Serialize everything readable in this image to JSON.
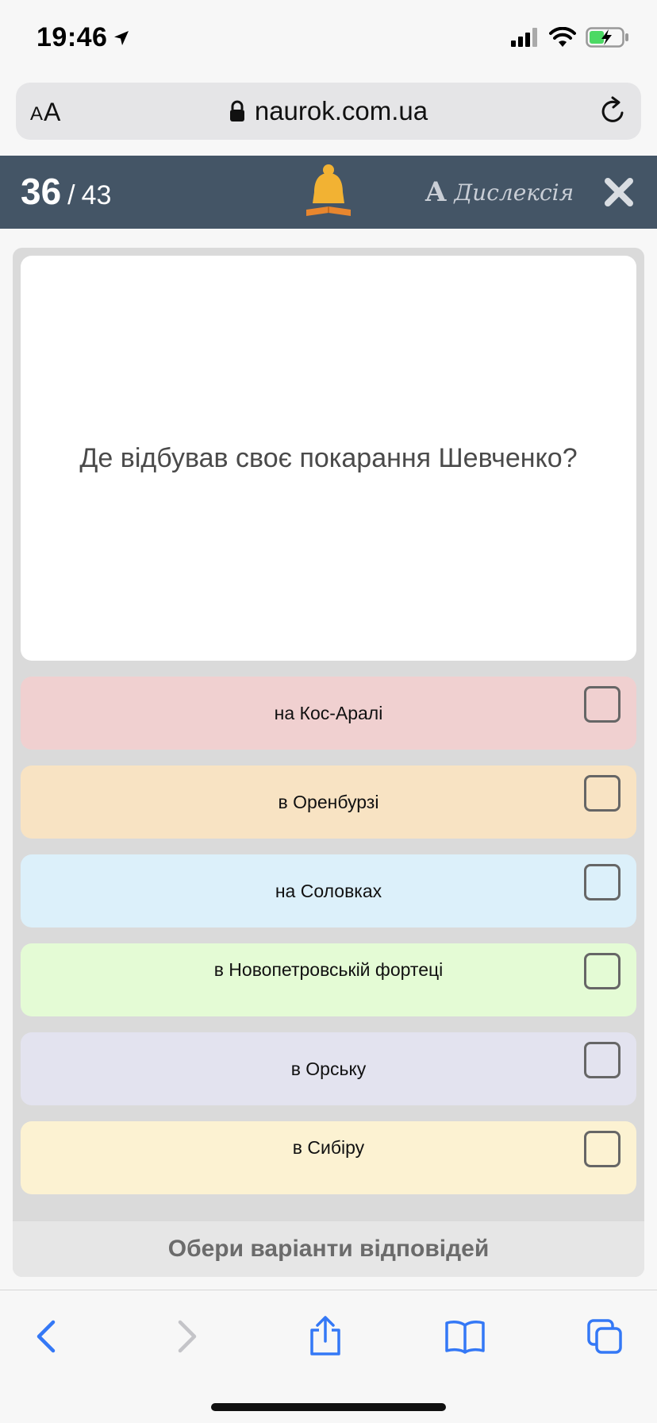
{
  "status_bar": {
    "time": "19:46"
  },
  "browser": {
    "text_size_small": "A",
    "text_size_large": "A",
    "url": "naurok.com.ua"
  },
  "quiz": {
    "progress_current": "36",
    "progress_separator": "/",
    "progress_total": "43",
    "dyslexia_letter": "A",
    "dyslexia_label": "Дислексія",
    "question": "Де відбував своє покарання Шевченко?",
    "answers": [
      {
        "label": "на Кос-Аралі",
        "color": "#f0d0d0",
        "checked": false
      },
      {
        "label": "в Оренбурзі",
        "color": "#f8e3c3",
        "checked": false
      },
      {
        "label": "на Соловках",
        "color": "#dcf0fa",
        "checked": false
      },
      {
        "label": "в Новопетровській фортеці",
        "color": "#e4fbd5",
        "checked": false
      },
      {
        "label": "в Орську",
        "color": "#e3e3ef",
        "checked": false
      },
      {
        "label": "в Сибіру",
        "color": "#fcf2d2",
        "checked": false
      }
    ],
    "instruction": "Обери варіанти відповідей"
  },
  "colors": {
    "header_bg": "#445566",
    "logo_bell": "#f2b233",
    "logo_book": "#e8862e"
  },
  "toolbar": {
    "icons": [
      "back-icon",
      "forward-icon",
      "share-icon",
      "bookmarks-icon",
      "tabs-icon"
    ]
  }
}
